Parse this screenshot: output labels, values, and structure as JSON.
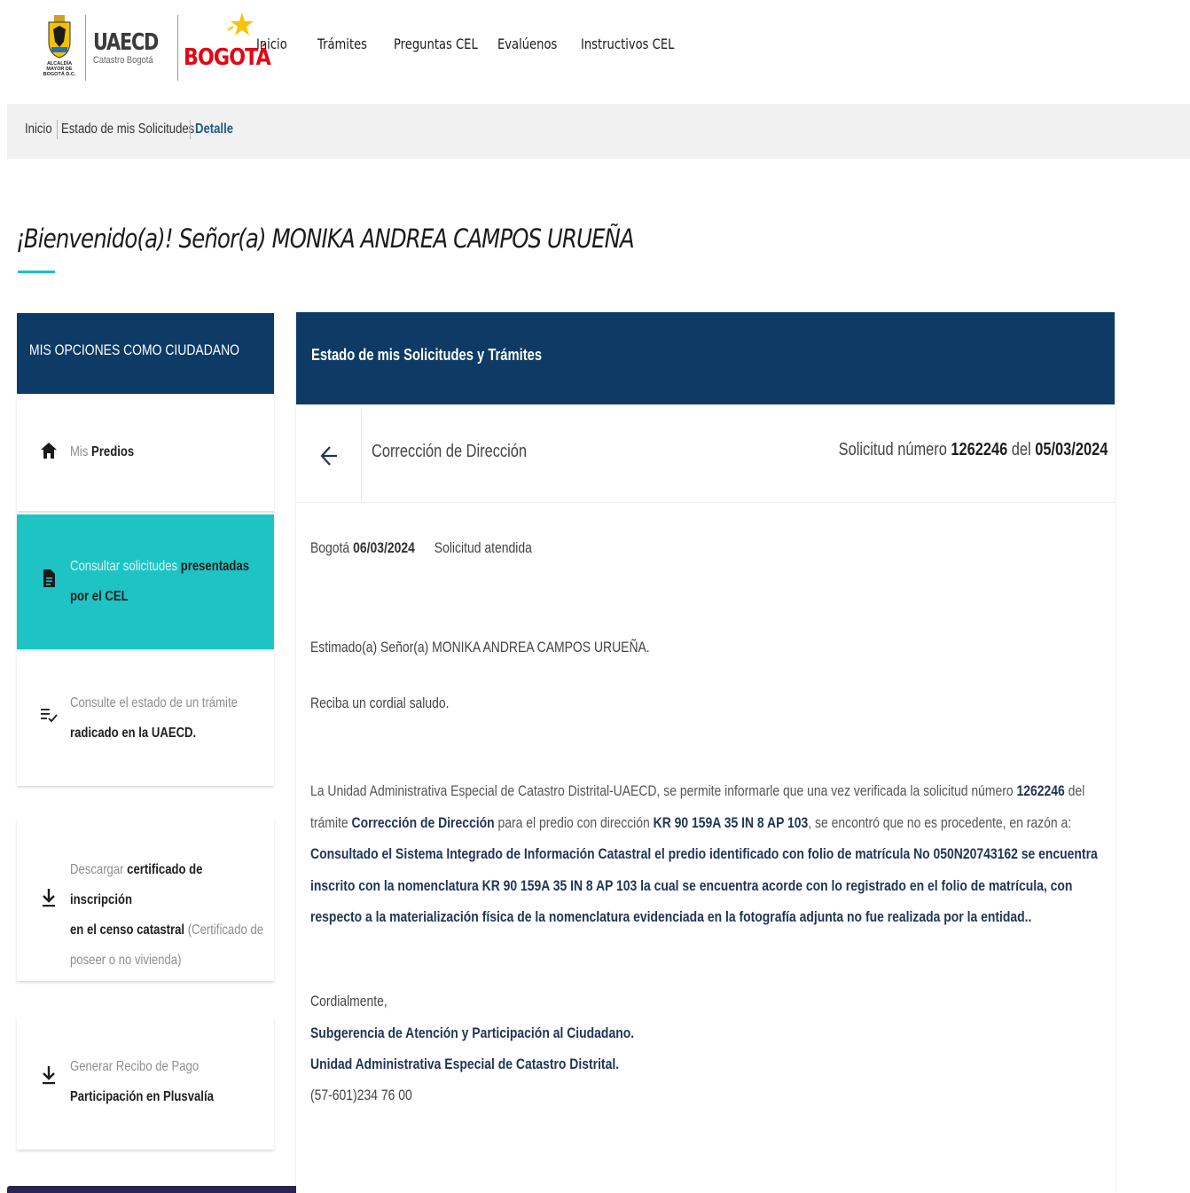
{
  "header": {
    "alcaldia_text": "ALCALDÍA MAYOR DE BOGOTÁ D.C.",
    "uaecd_title": "UAECD",
    "uaecd_subtitle": "Catastro Bogotá",
    "bogota_text": "BOGOTÁ",
    "nav": [
      "Inicio",
      "Trámites",
      "Preguntas CEL",
      "Evalúenos",
      "Instructivos CEL"
    ]
  },
  "breadcrumb": [
    "Inicio",
    "Estado de mis Solicitudes",
    "Detalle"
  ],
  "welcome": "¡Bienvenido(a)! Señor(a) MONIKA ANDREA CAMPOS URUEÑA",
  "sidebar": {
    "title": "MIS OPCIONES COMO CIUDADANO",
    "items": [
      {
        "icon": "home-icon",
        "light": "Mis",
        "bold": "Predios"
      },
      {
        "icon": "document-icon",
        "light": "Consultar solicitudes",
        "bold": "presentadas",
        "bold2": "por el CEL"
      },
      {
        "icon": "checklist-icon",
        "light": "Consulte el estado de un trámite",
        "bold": "radicado en la UAECD."
      },
      {
        "icon": "download-icon",
        "light": "Descargar",
        "bold": "certificado de inscripción",
        "bold2": "en el censo catastral",
        "light2": "(Certificado de",
        "light3": "poseer o no vivienda)"
      },
      {
        "icon": "download-icon",
        "light": "Generar Recibo de Pago",
        "bold": "Participación en Plusvalía"
      }
    ]
  },
  "main": {
    "title": "Estado de mis Solicitudes y Trámites",
    "tramite": "Corrección de Dirección",
    "solicitud_prefix": "Solicitud número",
    "solicitud_numero": "1262246",
    "solicitud_del": "del",
    "solicitud_fecha": "05/03/2024",
    "city": "Bogotá",
    "fecha": "06/03/2024",
    "estado": "Solicitud atendida",
    "saludo_1": "Estimado(a) Señor(a) MONIKA ANDREA CAMPOS URUEÑA.",
    "saludo_2": "Reciba un cordial saludo.",
    "par": {
      "t1": "La Unidad Administrativa Especial de Catastro Distrital-UAECD, se permite informarle que una vez verificada la solicitud número",
      "num": "1262246",
      "t2": "del trámite",
      "tramite": "Corrección de Dirección",
      "t3": "para el predio con dirección",
      "direccion": "KR 90 159A 35 IN 8 AP 103",
      "t4": ", se encontró que no es procedente, en razón a:",
      "razon": "Consultado el Sistema Integrado de Información Catastral el predio identificado con folio de matrícula No 050N20743162 se encuentra inscrito con la nomenclatura KR 90 159A 35 IN 8 AP 103 la cual se encuentra acorde con lo registrado en el folio de matrícula, con respecto a la materialización física de la nomenclatura evidenciada en la fotografía adjunta no fue realizada por la entidad.."
    },
    "closing": "Cordialmente,",
    "sign_1": "Subgerencia de Atención y Participación al Ciudadano.",
    "sign_2": "Unidad Administrativa Especial de Catastro Distrital.",
    "phone": "(57-601)234 76 00"
  },
  "colors": {
    "navy": "#0d3b66",
    "teal": "#1ec4c4",
    "accent_underline": "#18c2c2",
    "breadcrumb_active": "#1f5a8a",
    "bogota_red": "#e30613"
  }
}
